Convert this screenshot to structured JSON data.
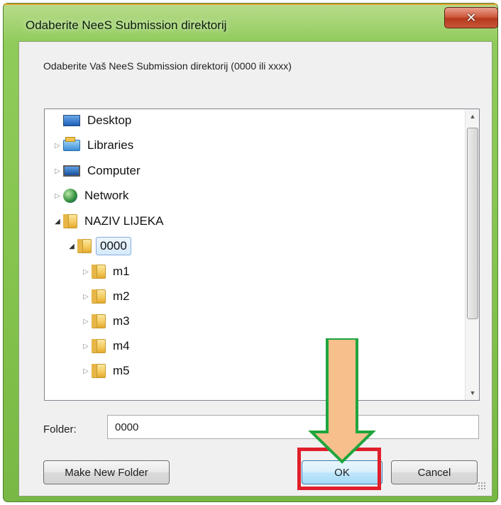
{
  "window": {
    "title": "Odaberite NeeS Submission direktorij",
    "close_glyph": "✕"
  },
  "dialog": {
    "description": "Odaberite Vaš NeeS Submission direktorij (0000 ili xxxx)"
  },
  "tree": {
    "items": [
      {
        "label": "Desktop",
        "icon": "desktop-icon",
        "expander": "",
        "selected": false
      },
      {
        "label": "Libraries",
        "icon": "libraries-icon",
        "expander": "▷",
        "selected": false
      },
      {
        "label": "Computer",
        "icon": "computer-icon",
        "expander": "▷",
        "selected": false
      },
      {
        "label": "Network",
        "icon": "network-icon",
        "expander": "▷",
        "selected": false
      },
      {
        "label": "NAZIV LIJEKA",
        "icon": "folder-icon",
        "expander": "◢",
        "selected": false
      },
      {
        "label": "0000",
        "icon": "folder-icon",
        "expander": "◢",
        "selected": true
      },
      {
        "label": "m1",
        "icon": "folder-icon",
        "expander": "▷",
        "selected": false
      },
      {
        "label": "m2",
        "icon": "folder-icon",
        "expander": "▷",
        "selected": false
      },
      {
        "label": "m3",
        "icon": "folder-icon",
        "expander": "▷",
        "selected": false
      },
      {
        "label": "m4",
        "icon": "folder-icon",
        "expander": "▷",
        "selected": false
      },
      {
        "label": "m5",
        "icon": "folder-icon",
        "expander": "▷",
        "selected": false
      }
    ],
    "scroll_up": "▲",
    "scroll_down": "▼"
  },
  "folder_field": {
    "label": "Folder:",
    "value": "0000"
  },
  "buttons": {
    "make_new_folder": "Make New Folder",
    "ok": "OK",
    "cancel": "Cancel"
  },
  "colors": {
    "frame_green": "#83c24c",
    "annotation_arrow_fill": "#f6bf8c",
    "annotation_arrow_stroke": "#1fa53d",
    "highlight_red": "#e01f2a"
  }
}
